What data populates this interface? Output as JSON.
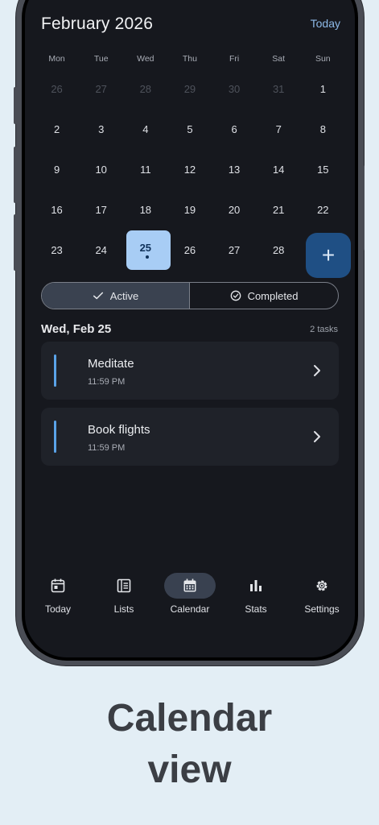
{
  "header": {
    "month_title": "February 2026",
    "today_link": "Today"
  },
  "calendar": {
    "weekdays": [
      "Mon",
      "Tue",
      "Wed",
      "Thu",
      "Fri",
      "Sat",
      "Sun"
    ],
    "days": [
      {
        "n": "26",
        "muted": true
      },
      {
        "n": "27",
        "muted": true
      },
      {
        "n": "28",
        "muted": true
      },
      {
        "n": "29",
        "muted": true
      },
      {
        "n": "30",
        "muted": true
      },
      {
        "n": "31",
        "muted": true
      },
      {
        "n": "1"
      },
      {
        "n": "2"
      },
      {
        "n": "3"
      },
      {
        "n": "4"
      },
      {
        "n": "5"
      },
      {
        "n": "6"
      },
      {
        "n": "7"
      },
      {
        "n": "8"
      },
      {
        "n": "9"
      },
      {
        "n": "10"
      },
      {
        "n": "11"
      },
      {
        "n": "12"
      },
      {
        "n": "13"
      },
      {
        "n": "14"
      },
      {
        "n": "15"
      },
      {
        "n": "16"
      },
      {
        "n": "17"
      },
      {
        "n": "18"
      },
      {
        "n": "19"
      },
      {
        "n": "20"
      },
      {
        "n": "21"
      },
      {
        "n": "22"
      },
      {
        "n": "23"
      },
      {
        "n": "24"
      },
      {
        "n": "25",
        "selected": true,
        "has_tasks": true
      },
      {
        "n": "26"
      },
      {
        "n": "27"
      },
      {
        "n": "28"
      }
    ],
    "add_icon": "plus-icon"
  },
  "filter": {
    "active_label": "Active",
    "completed_label": "Completed",
    "selected": "Active"
  },
  "day_section": {
    "date_title": "Wed, Feb 25",
    "task_count": "2 tasks"
  },
  "tasks": [
    {
      "title": "Meditate",
      "time": "11:59 PM"
    },
    {
      "title": "Book flights",
      "time": "11:59 PM"
    }
  ],
  "nav": {
    "items": [
      {
        "label": "Today",
        "icon": "calendar-day-icon"
      },
      {
        "label": "Lists",
        "icon": "list-icon"
      },
      {
        "label": "Calendar",
        "icon": "calendar-icon"
      },
      {
        "label": "Stats",
        "icon": "bar-chart-icon"
      },
      {
        "label": "Settings",
        "icon": "gear-icon"
      }
    ],
    "active": "Calendar"
  },
  "caption": {
    "line1": "Calendar",
    "line2": "view"
  },
  "colors": {
    "accent": "#a8cdf5",
    "fab": "#1f4f84",
    "task_bar": "#5aa3e8",
    "background": "#16181e"
  }
}
